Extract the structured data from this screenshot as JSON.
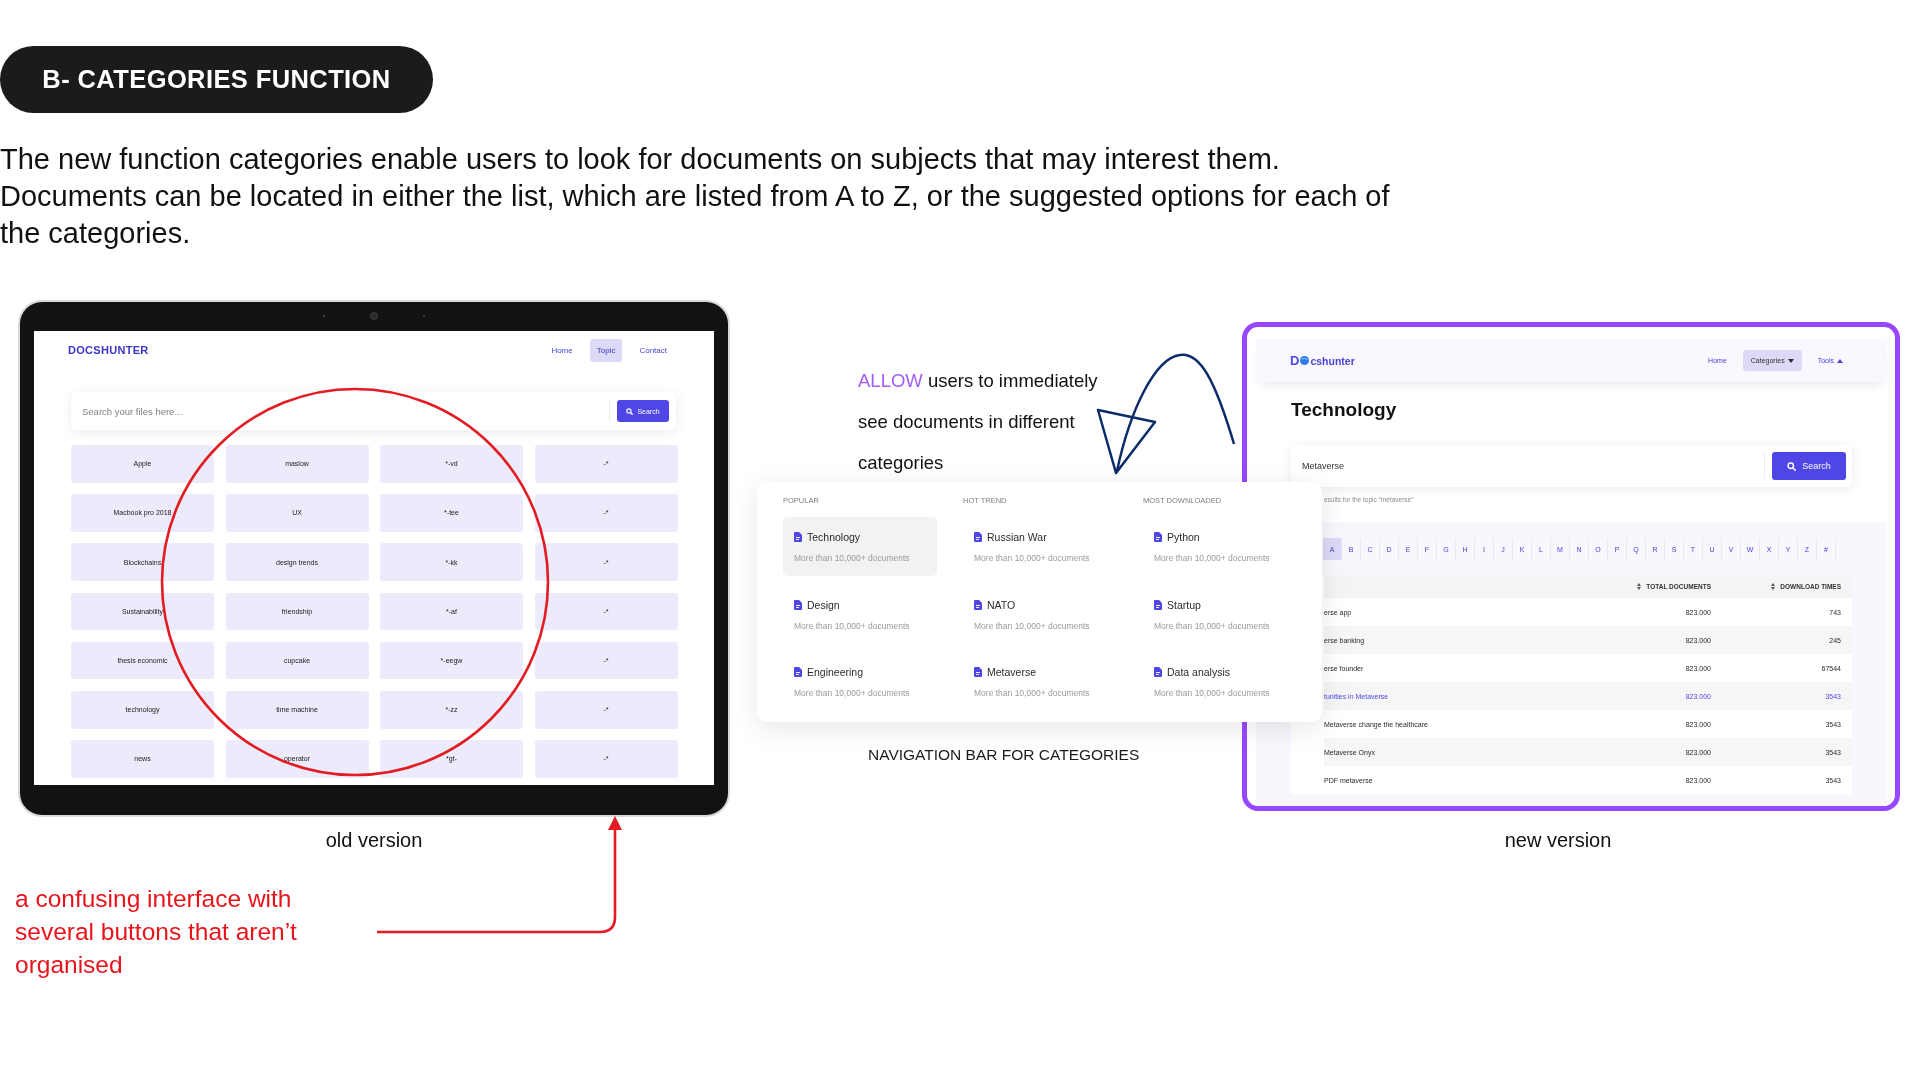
{
  "header": {
    "title": "B- CATEGORIES FUNCTION"
  },
  "intro": "The new function categories enable users to look for documents on subjects that may interest them. Documents can be located in either the list, which are listed from A to Z, or the suggested options for each of the categories.",
  "old_version": {
    "app": {
      "logo": "DOCSHUNTER",
      "nav": [
        {
          "label": "Home",
          "selected": false
        },
        {
          "label": "Topic",
          "selected": true
        },
        {
          "label": "Contact",
          "selected": false
        }
      ],
      "search": {
        "placeholder": "Search your files here...",
        "button": "Search"
      },
      "topic_grid": [
        [
          "Apple",
          "maslow",
          "*-vd",
          "-*"
        ],
        [
          "Macbook pro 2018",
          "UX",
          "*-tee",
          "-*"
        ],
        [
          "Blockchains",
          "design trends",
          "*-kk",
          "-*"
        ],
        [
          "Sustainability",
          "friendship",
          "*-af",
          "-*"
        ],
        [
          "thesis economic",
          "cupcake",
          "*-eegw",
          "-*"
        ],
        [
          "technology",
          "time machine",
          "*-zz",
          "-*"
        ],
        [
          "news",
          "operator",
          "*gt-",
          "-*"
        ]
      ]
    },
    "caption": "old version"
  },
  "annotation": {
    "highlight": "ALLOW",
    "text": "users to immediately see documents in different categories"
  },
  "category_menu": {
    "columns": [
      {
        "heading": "POPULAR",
        "items": [
          {
            "title": "Technology",
            "subtitle": "More than 10,000+ documents",
            "selected": true
          },
          {
            "title": "Design",
            "subtitle": "More than 10,000+ documents",
            "selected": false
          },
          {
            "title": "Engineering",
            "subtitle": "More than 10,000+ documents",
            "selected": false
          }
        ]
      },
      {
        "heading": "HOT TREND",
        "items": [
          {
            "title": "Russian War",
            "subtitle": "More than 10,000+ documents",
            "selected": false
          },
          {
            "title": "NATO",
            "subtitle": "More than 10,000+ documents",
            "selected": false
          },
          {
            "title": "Metaverse",
            "subtitle": "More than 10,000+ documents",
            "selected": false
          }
        ]
      },
      {
        "heading": "MOST DOWNLOADED",
        "items": [
          {
            "title": "Python",
            "subtitle": "More than 10,000+ documents",
            "selected": false
          },
          {
            "title": "Startup",
            "subtitle": "More than 10,000+ documents",
            "selected": false
          },
          {
            "title": "Data analysis",
            "subtitle": "More than 10,000+ documents",
            "selected": false
          }
        ]
      }
    ],
    "caption": "NAVIGATION BAR FOR CATEGORIES"
  },
  "new_version": {
    "app": {
      "logo": {
        "initial": "D",
        "rest": "cshunter"
      },
      "nav": [
        {
          "kind": "link",
          "label": "Home",
          "selected": false
        },
        {
          "kind": "menu",
          "label": "Categories",
          "selected": true,
          "expanded": false
        },
        {
          "kind": "menu",
          "label": "Tools",
          "selected": false,
          "expanded": true
        }
      ],
      "title": "Technology",
      "search": {
        "value": "Metaverse",
        "button": "Search"
      },
      "results_note": "esults for the topic \"metaverse\"",
      "alphabet": [
        {
          "label": "A",
          "selected": true
        },
        {
          "label": "B",
          "selected": false
        },
        {
          "label": "C",
          "selected": false
        },
        {
          "label": "D",
          "selected": false
        },
        {
          "label": "E",
          "selected": false
        },
        {
          "label": "F",
          "selected": false
        },
        {
          "label": "G",
          "selected": false
        },
        {
          "label": "H",
          "selected": false
        },
        {
          "label": "I",
          "selected": false
        },
        {
          "label": "J",
          "selected": false
        },
        {
          "label": "K",
          "selected": false
        },
        {
          "label": "L",
          "selected": false
        },
        {
          "label": "M",
          "selected": false
        },
        {
          "label": "N",
          "selected": false
        },
        {
          "label": "O",
          "selected": false
        },
        {
          "label": "P",
          "selected": false
        },
        {
          "label": "Q",
          "selected": false
        },
        {
          "label": "R",
          "selected": false
        },
        {
          "label": "S",
          "selected": false
        },
        {
          "label": "T",
          "selected": false
        },
        {
          "label": "U",
          "selected": false
        },
        {
          "label": "V",
          "selected": false
        },
        {
          "label": "W",
          "selected": false
        },
        {
          "label": "X",
          "selected": false
        },
        {
          "label": "Y",
          "selected": false
        },
        {
          "label": "Z",
          "selected": false
        },
        {
          "label": "#",
          "selected": false
        }
      ],
      "table": {
        "columns": [
          "",
          "TOTAL DOCUMENTS",
          "DOWNLOAD TIMES"
        ],
        "rows": [
          {
            "cells": [
              "erse app",
              "823.000",
              "743"
            ],
            "selected": false
          },
          {
            "cells": [
              "erse banking",
              "823.000",
              "245"
            ],
            "selected": false
          },
          {
            "cells": [
              "erse founder",
              "823.000",
              "67544"
            ],
            "selected": false
          },
          {
            "cells": [
              "tunities in Metaverse",
              "823.000",
              "3543"
            ],
            "selected": true
          },
          {
            "cells": [
              "Metaverse change the healthcare",
              "823.000",
              "3543"
            ],
            "selected": false
          },
          {
            "cells": [
              "Metaverse Onyx",
              "823.000",
              "3543"
            ],
            "selected": false
          },
          {
            "cells": [
              "PDF metaverse",
              "823.000",
              "3543"
            ],
            "selected": false
          }
        ]
      }
    },
    "caption": "new version"
  },
  "note": "a confusing interface with several buttons that aren’t organised"
}
